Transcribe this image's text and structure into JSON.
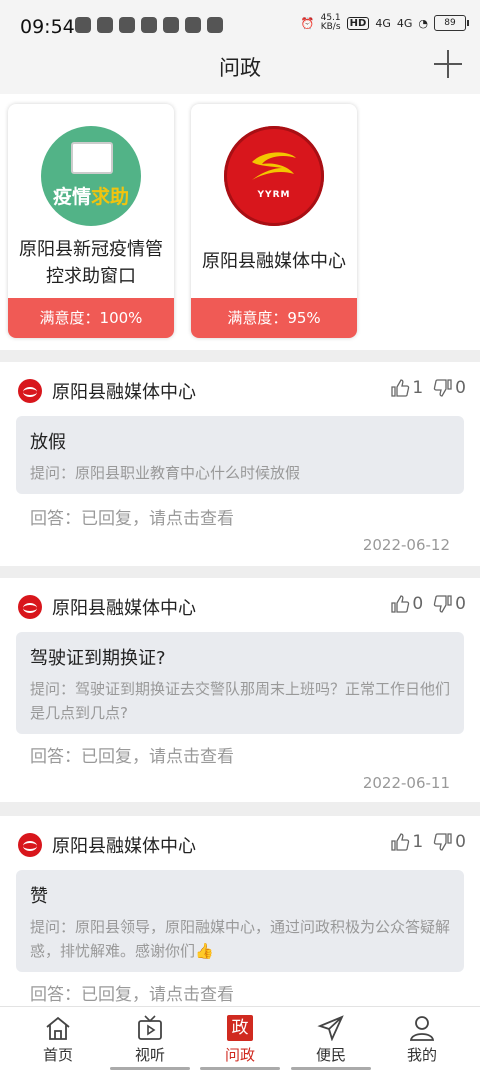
{
  "status_bar": {
    "time": "09:54",
    "net_speed": "45.1\nKB/s",
    "battery": "89",
    "hd": "HD",
    "sig1": "4G",
    "sig2": "4G"
  },
  "header": {
    "title": "问政"
  },
  "cards": [
    {
      "title": "原阳县新冠疫情管控求助窗口",
      "logo_text_a": "疫情",
      "logo_text_b": "求助",
      "satisfaction": "满意度：100%"
    },
    {
      "title": "原阳县融媒体中心",
      "logo_text": "YYRM",
      "satisfaction": "满意度：95%"
    }
  ],
  "posts": [
    {
      "source": "原阳县融媒体中心",
      "likes": "1",
      "dislikes": "0",
      "title": "放假",
      "question": "提问：原阳县职业教育中心什么时候放假",
      "answer": "回答：已回复，请点击查看",
      "date": "2022-06-12"
    },
    {
      "source": "原阳县融媒体中心",
      "likes": "0",
      "dislikes": "0",
      "title": "驾驶证到期换证?",
      "question": "提问：驾驶证到期换证去交警队那周末上班吗？正常工作日他们是几点到几点?",
      "answer": "回答：已回复，请点击查看",
      "date": "2022-06-11"
    },
    {
      "source": "原阳县融媒体中心",
      "likes": "1",
      "dislikes": "0",
      "title": "赞",
      "question": "提问：原阳县领导，原阳融媒中心，通过问政积极为公众答疑解惑，排忧解难。感谢你们👍",
      "answer": "回答：已回复，请点击查看",
      "date": ""
    }
  ],
  "tabs": [
    {
      "label": "首页",
      "icon": "home-icon"
    },
    {
      "label": "视听",
      "icon": "tv-icon"
    },
    {
      "label": "问政",
      "icon": "wenzheng-icon",
      "active_glyph": "政"
    },
    {
      "label": "便民",
      "icon": "send-icon"
    },
    {
      "label": "我的",
      "icon": "user-icon"
    }
  ],
  "colors": {
    "accent": "#d02a20",
    "satisfaction_bar": "#f05a55"
  }
}
